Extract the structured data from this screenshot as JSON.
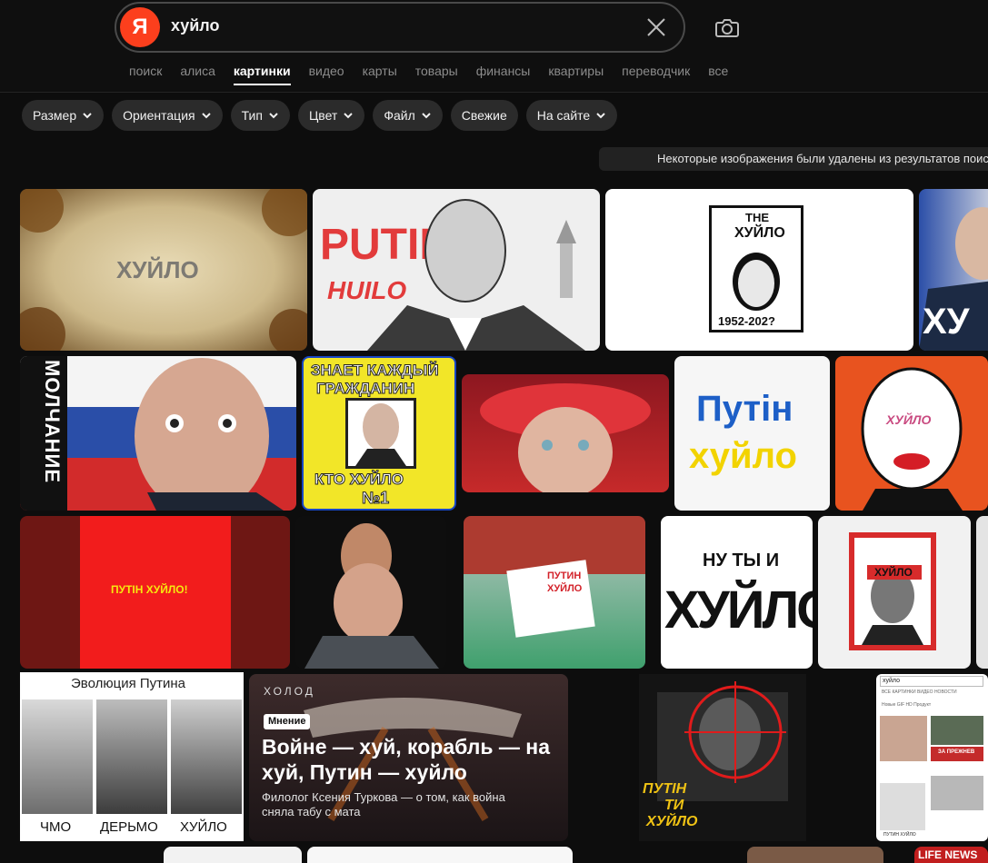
{
  "search": {
    "query": "хуйло"
  },
  "logo": "Я",
  "tabs": [
    {
      "label": "поиск"
    },
    {
      "label": "алиса"
    },
    {
      "label": "картинки",
      "active": true
    },
    {
      "label": "видео"
    },
    {
      "label": "карты"
    },
    {
      "label": "товары"
    },
    {
      "label": "финансы"
    },
    {
      "label": "квартиры"
    },
    {
      "label": "переводчик"
    },
    {
      "label": "все"
    }
  ],
  "filters": {
    "size": "Размер",
    "orientation": "Ориентация",
    "type": "Тип",
    "color": "Цвет",
    "file": "Файл",
    "fresh": "Свежие",
    "site": "На сайте"
  },
  "notice": "Некоторые изображения были удалены из результатов поис",
  "images": {
    "t1": "ХУЙЛО",
    "t2a": "PUTIN",
    "t2b": "HUILO",
    "t3a": "THE",
    "t3b": "ХУЙЛО",
    "t3c": "1952-202?",
    "t4": "ХУ",
    "t5": "МОЛЧАНИЕ",
    "t6a": "ЗНАЕТ КАЖДЫЙ",
    "t6b": "ГРАЖДАНИН",
    "t6c": "КТО ХУЙЛО",
    "t6d": "№1",
    "t8a": "Путін",
    "t8b": "хуйло",
    "t9": "ХУЙЛО",
    "t10": "ПУТІН ХУЙЛО!",
    "t12a": "ПУТИН",
    "t12b": "ХУЙЛО",
    "t13a": "НУ ТЫ И",
    "t13b": "ХУЙЛО",
    "t14": "ХУЙЛО",
    "evo_title": "Эволюция Путина",
    "evo_c1": "ЧМО",
    "evo_c2": "ДЕРЬМО",
    "evo_c3": "ХУЙЛО",
    "article_brand": "ХОЛОД",
    "article_tag": "Мнение",
    "article_title": "Войне — хуй, корабль — на хуй, Путин — хуйло",
    "article_sub": "Филолог Ксения Туркова — о том, как война сняла табу с мата",
    "target_a": "ПУТІН",
    "target_b": "ТИ",
    "target_c": "ХУЙЛО",
    "mini_query": "хуйло",
    "mini_tabs": "ВСЕ   КАРТИНКИ   ВИДЕО   НОВОСТИ",
    "mini_filters": "Новые   GIF   HD   Продукт",
    "mini_cap": "ПУТИН ХУЙЛО",
    "mini_cap2": "ЗА ПРЕЖНЕВ",
    "lifenews": "LIFE NEWS"
  }
}
